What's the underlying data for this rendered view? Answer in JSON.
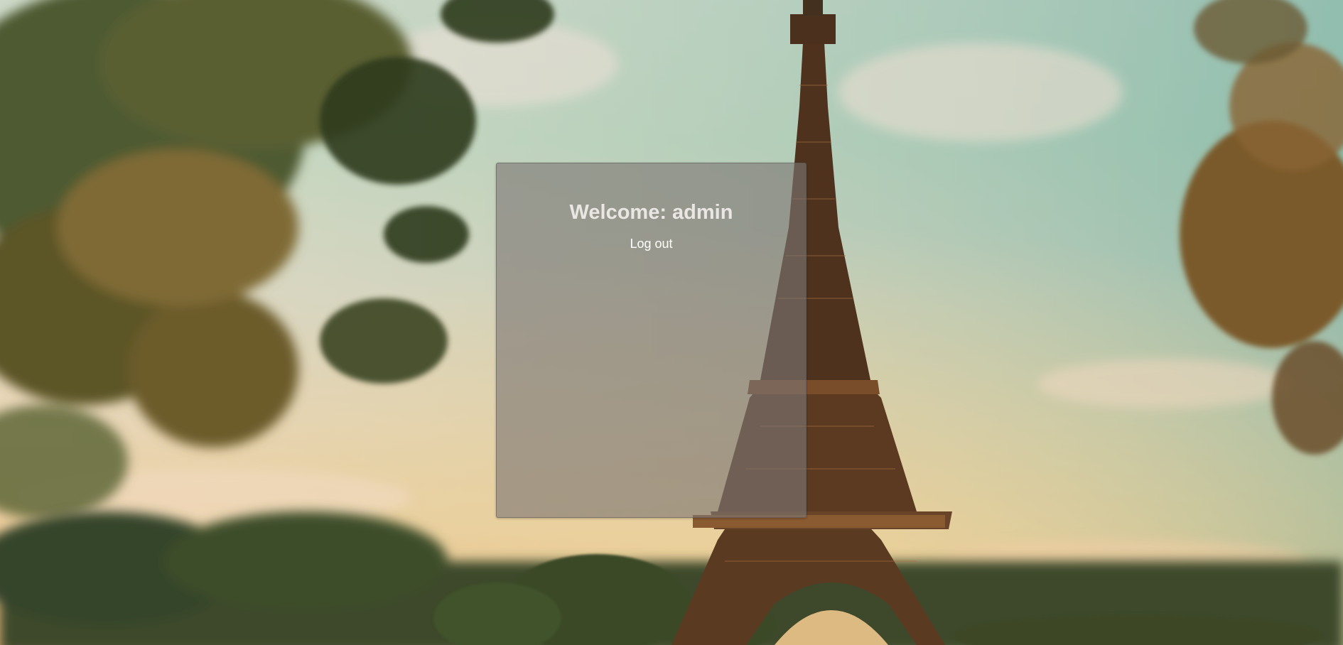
{
  "welcome": {
    "prefix": "Welcome:",
    "username": "admin"
  },
  "actions": {
    "logout_label": "Log out"
  },
  "colors": {
    "panel_text": "#e9e6e3",
    "link_text": "#ffffff",
    "panel_bg": "rgba(125,118,115,0.62)"
  }
}
